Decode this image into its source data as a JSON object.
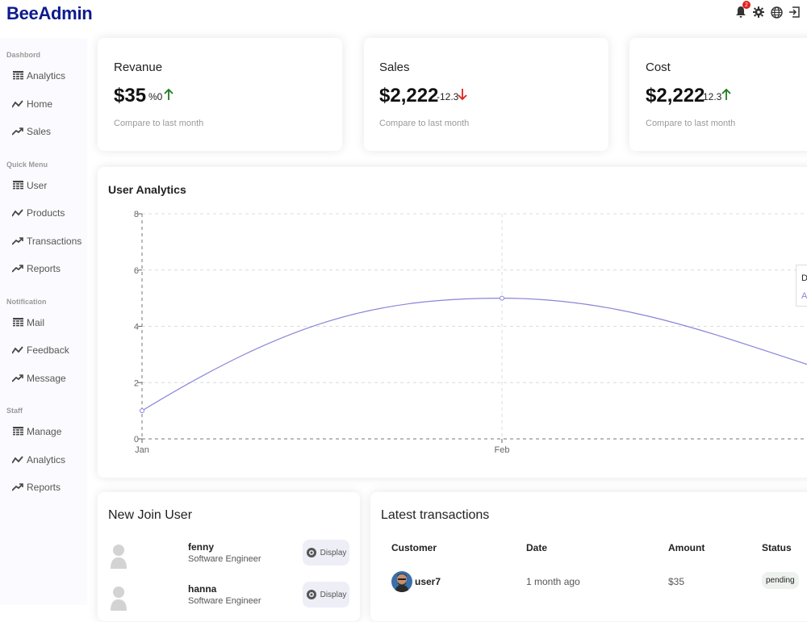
{
  "app": {
    "logo": "BeeAdmin",
    "notification_count": "2"
  },
  "sidebar": {
    "sections": [
      {
        "title": "Dashbord",
        "items": [
          {
            "label": "Analytics",
            "icon": "table-icon"
          },
          {
            "label": "Home",
            "icon": "line-chart-icon"
          },
          {
            "label": "Sales",
            "icon": "trending-up-icon"
          }
        ]
      },
      {
        "title": "Quick Menu",
        "items": [
          {
            "label": "User",
            "icon": "table-icon"
          },
          {
            "label": "Products",
            "icon": "line-chart-icon"
          },
          {
            "label": "Transactions",
            "icon": "trending-up-icon"
          },
          {
            "label": "Reports",
            "icon": "trending-up-icon"
          }
        ]
      },
      {
        "title": "Notification",
        "items": [
          {
            "label": "Mail",
            "icon": "table-icon"
          },
          {
            "label": "Feedback",
            "icon": "line-chart-icon"
          },
          {
            "label": "Message",
            "icon": "trending-up-icon"
          }
        ]
      },
      {
        "title": "Staff",
        "items": [
          {
            "label": "Manage",
            "icon": "table-icon"
          },
          {
            "label": "Analytics",
            "icon": "line-chart-icon"
          },
          {
            "label": "Reports",
            "icon": "trending-up-icon"
          }
        ]
      }
    ]
  },
  "featured": [
    {
      "title": "Revanue",
      "money": "$35",
      "rate": "%0",
      "direction": "up",
      "sub": "Compare to last month"
    },
    {
      "title": "Sales",
      "money": "$2,222",
      "rate": "-12.3",
      "direction": "down",
      "sub": "Compare to last month"
    },
    {
      "title": "Cost",
      "money": "$2,222",
      "rate": "12.3",
      "direction": "up",
      "sub": "Compare to last month"
    }
  ],
  "colors": {
    "up": "#1f7a1f",
    "down": "#e0201c",
    "line": "#8884d8",
    "logo": "#0d1b8c"
  },
  "analytics": {
    "title": "User Analytics",
    "tooltip_label": "D",
    "tooltip_value": "A"
  },
  "chart_data": {
    "type": "line",
    "title": "User Analytics",
    "x": [
      "Jan",
      "Feb"
    ],
    "series": [
      {
        "values": [
          1,
          5
        ]
      }
    ],
    "ylim": [
      0,
      8
    ],
    "yticks": [
      "0",
      "2",
      "4",
      "6",
      "8"
    ],
    "grid": true
  },
  "new_users": {
    "title": "New Join User",
    "button_label": "Display",
    "items": [
      {
        "name": "fenny",
        "title": "Software Engineer"
      },
      {
        "name": "hanna",
        "title": "Software Engineer"
      }
    ]
  },
  "transactions": {
    "title": "Latest transactions",
    "headers": [
      "Customer",
      "Date",
      "Amount",
      "Status"
    ],
    "rows": [
      {
        "customer": "user7",
        "date": "1 month ago",
        "amount": "$35",
        "status": "pending"
      }
    ]
  }
}
